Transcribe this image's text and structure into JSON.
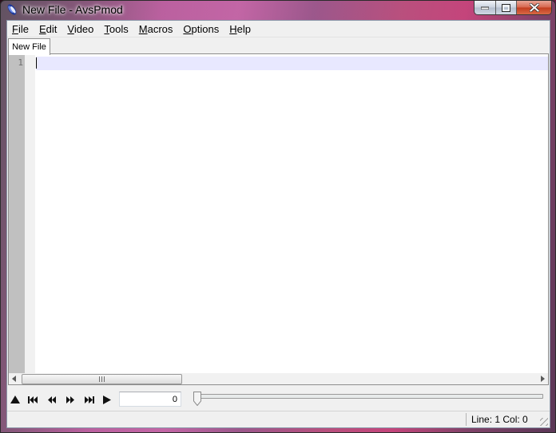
{
  "window": {
    "title": "New File - AvsPmod"
  },
  "menu": {
    "items": [
      {
        "mnemonic": "F",
        "rest": "ile"
      },
      {
        "mnemonic": "E",
        "rest": "dit"
      },
      {
        "mnemonic": "V",
        "rest": "ideo"
      },
      {
        "mnemonic": "T",
        "rest": "ools"
      },
      {
        "mnemonic": "M",
        "rest": "acros"
      },
      {
        "mnemonic": "O",
        "rest": "ptions"
      },
      {
        "mnemonic": "H",
        "rest": "elp"
      }
    ]
  },
  "tabs": [
    {
      "label": "New File"
    }
  ],
  "editor": {
    "line_numbers": [
      "1"
    ],
    "current_line_color": "#e8e8ff",
    "gutter_color": "#c0c0c0"
  },
  "transport": {
    "frame_value": "0",
    "slider_position": 0,
    "buttons": [
      "toggle-preview-icon",
      "go-to-start-icon",
      "previous-frame-icon",
      "next-frame-icon",
      "go-to-end-icon",
      "play-icon"
    ]
  },
  "status": {
    "position_text": "Line: 1  Col: 0"
  }
}
